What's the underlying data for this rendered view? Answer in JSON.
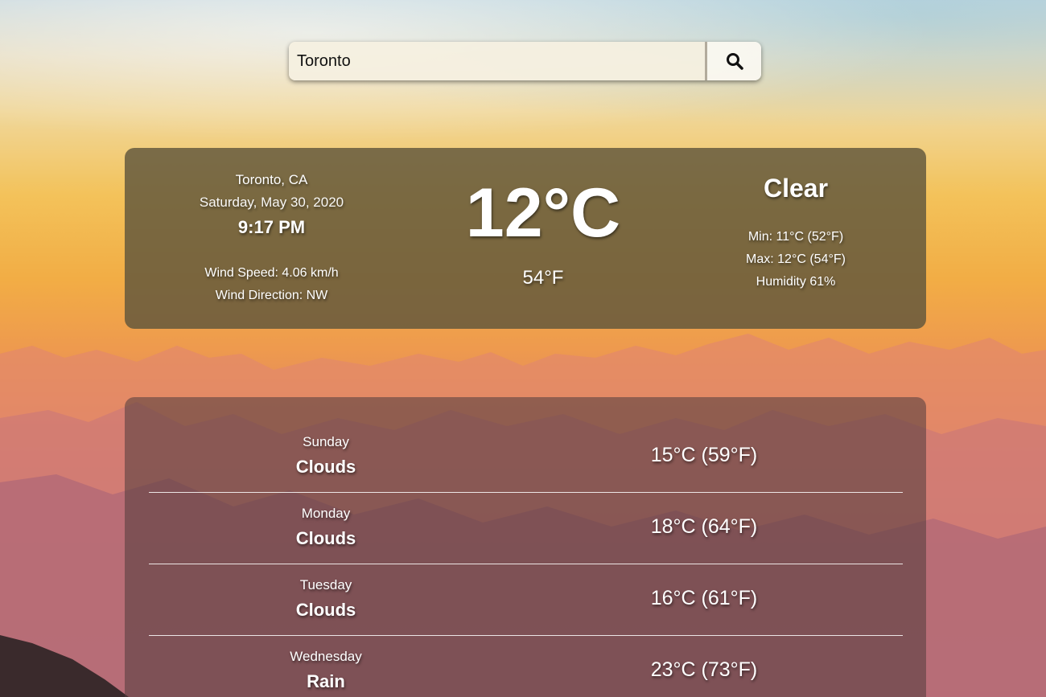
{
  "search": {
    "value": "Toronto",
    "button_icon": "search-icon"
  },
  "current": {
    "location": "Toronto, CA",
    "date": "Saturday, May 30, 2020",
    "time": "9:17 PM",
    "wind_speed": "Wind Speed: 4.06 km/h",
    "wind_direction": "Wind Direction: NW",
    "temp_c": "12°C",
    "temp_f": "54°F",
    "condition": "Clear",
    "min": "Min: 11°C (52°F)",
    "max": "Max: 12°C (54°F)",
    "humidity": "Humidity 61%"
  },
  "forecast": [
    {
      "day": "Sunday",
      "condition": "Clouds",
      "temp": "15°C (59°F)"
    },
    {
      "day": "Monday",
      "condition": "Clouds",
      "temp": "18°C (64°F)"
    },
    {
      "day": "Tuesday",
      "condition": "Clouds",
      "temp": "16°C (61°F)"
    },
    {
      "day": "Wednesday",
      "condition": "Rain",
      "temp": "23°C (73°F)"
    }
  ]
}
